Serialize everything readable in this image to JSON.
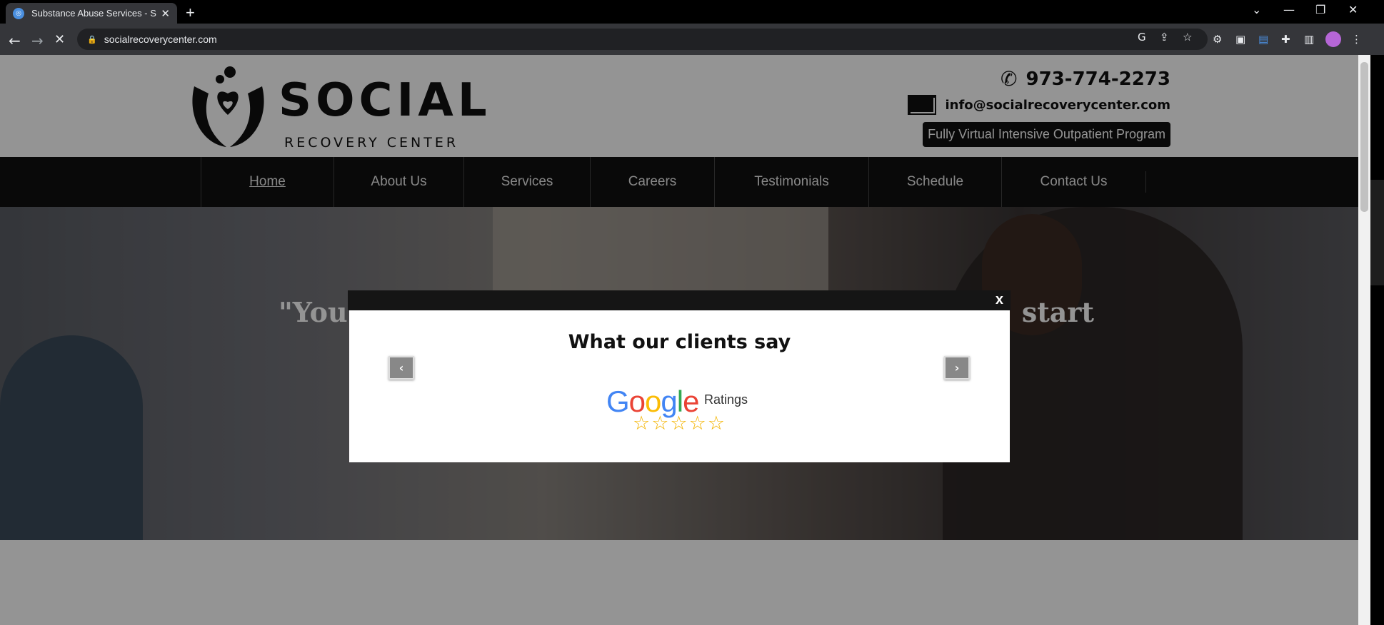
{
  "browser": {
    "tab_title": "Substance Abuse Services - Socia",
    "tab_close": "✕",
    "new_tab": "+",
    "url": "socialrecoverycenter.com",
    "window_controls": [
      "⌄",
      "—",
      "❐",
      "✕"
    ]
  },
  "site": {
    "logo_word": "SOCIAL",
    "logo_sub": "RECOVERY CENTER",
    "phone": "973-774-2273",
    "email": "info@socialrecoverycenter.com",
    "program_badge": "Fully Virtual Intensive Outpatient Program",
    "nav": [
      {
        "label": "Home",
        "active": true
      },
      {
        "label": "About Us"
      },
      {
        "label": "Services"
      },
      {
        "label": "Careers"
      },
      {
        "label": "Testimonials"
      },
      {
        "label": "Schedule"
      },
      {
        "label": "Contact Us"
      }
    ],
    "hero_quote_left": "\"You c",
    "hero_quote_right": "start"
  },
  "modal": {
    "close": "x",
    "heading": "What our clients say",
    "prev": "‹",
    "next": "›",
    "google_word": "Google",
    "ratings_label": "Ratings",
    "stars": "☆☆☆☆☆"
  },
  "icons": {
    "back": "back-arrow-icon",
    "forward": "forward-arrow-icon",
    "reload": "stop-loading-icon",
    "lock": "lock-icon",
    "phone": "phone-icon",
    "email": "envelope-icon"
  }
}
